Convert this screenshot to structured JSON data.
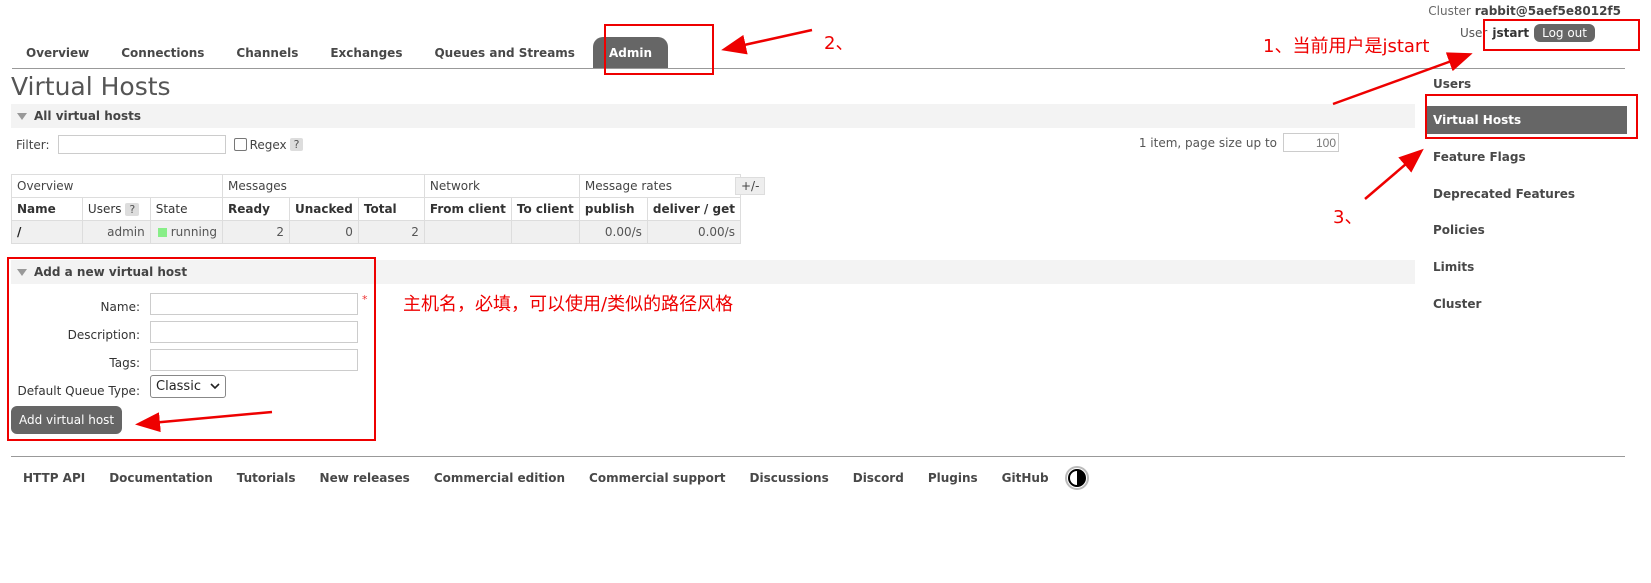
{
  "header": {
    "cluster_label": "Cluster",
    "cluster_name": "rabbit@5aef5e8012f5",
    "user_label": "User",
    "user_name": "jstart",
    "logout_label": "Log out"
  },
  "tabs": [
    "Overview",
    "Connections",
    "Channels",
    "Exchanges",
    "Queues and Streams",
    "Admin"
  ],
  "page_title": "Virtual Hosts",
  "all_vhosts": {
    "section_label": "All virtual hosts",
    "filter_label": "Filter:",
    "filter_value": "",
    "regex_label": "Regex",
    "help": "?",
    "paging_text": "1 item, page size up to",
    "page_size": "100"
  },
  "table": {
    "groups": [
      "Overview",
      "Messages",
      "Network",
      "Message rates"
    ],
    "columns": [
      "Name",
      "Users",
      "State",
      "Ready",
      "Unacked",
      "Total",
      "From client",
      "To client",
      "publish",
      "deliver / get"
    ],
    "rows": [
      [
        "/",
        "admin",
        "running",
        "2",
        "0",
        "2",
        "",
        "",
        "0.00/s",
        "0.00/s"
      ]
    ],
    "toggle_label": "+/-"
  },
  "add_form": {
    "section_label": "Add a new virtual host",
    "name_label": "Name:",
    "description_label": "Description:",
    "tags_label": "Tags:",
    "queue_type_label": "Default Queue Type:",
    "queue_type_value": "Classic",
    "required_mark": "*",
    "submit_label": "Add virtual host"
  },
  "sidebar": {
    "items": [
      "Users",
      "Virtual Hosts",
      "Feature Flags",
      "Deprecated Features",
      "Policies",
      "Limits",
      "Cluster"
    ],
    "active": "Virtual Hosts"
  },
  "footer": {
    "links": [
      "HTTP API",
      "Documentation",
      "Tutorials",
      "New releases",
      "Commercial edition",
      "Commercial support",
      "Discussions",
      "Discord",
      "Plugins",
      "GitHub"
    ]
  },
  "annotations": {
    "step1": "1、当前用户是jstart",
    "step2": "2、",
    "step3": "3、",
    "name_hint": "主机名，必填，可以使用/类似的路径风格"
  },
  "colors": {
    "accent_gray": "#666666",
    "annotation_red": "#ee0000",
    "running_green": "#88ee88"
  }
}
